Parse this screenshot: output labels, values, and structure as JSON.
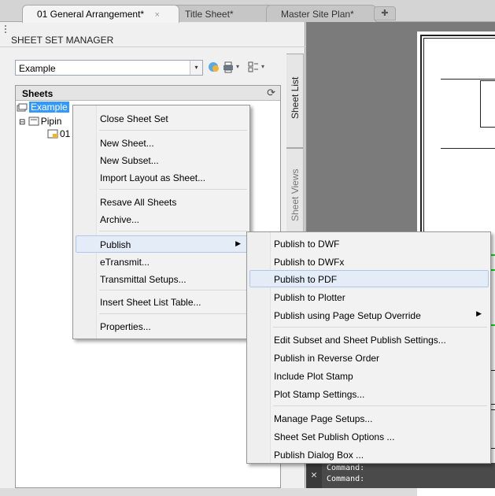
{
  "tabs": [
    {
      "label": "01 General Arrangement*",
      "close": "×",
      "active": true
    },
    {
      "label": "Title Sheet*",
      "active": false
    },
    {
      "label": "Master Site Plan*",
      "active": false
    }
  ],
  "palette": {
    "title": "SHEET SET MANAGER",
    "sheet_set_selector": {
      "value": "Example",
      "arrow": "▾"
    },
    "toolbar_icons": [
      "sheet-set-icon",
      "publish-icon",
      "view-options-icon"
    ],
    "sheets_header": "Sheets",
    "refresh_glyph": "⟳",
    "tree": [
      {
        "label": "Example",
        "selected": true
      },
      {
        "label": "Pipin"
      },
      {
        "label": "01"
      }
    ],
    "side_tabs": [
      "Sheet List",
      "Sheet Views"
    ]
  },
  "context_menu": {
    "items": [
      {
        "label": "Close Sheet Set"
      },
      {
        "label": "New Sheet..."
      },
      {
        "label": "New Subset..."
      },
      {
        "label": "Import Layout as Sheet..."
      },
      {
        "label": "Resave All Sheets"
      },
      {
        "label": "Archive..."
      },
      {
        "label": "Publish",
        "submenu": true
      },
      {
        "label": "eTransmit..."
      },
      {
        "label": "Transmittal Setups..."
      },
      {
        "label": "Insert Sheet List Table..."
      },
      {
        "label": "Properties..."
      }
    ],
    "submenu_arrow": "▶"
  },
  "publish_submenu": {
    "items": [
      {
        "label": "Publish to DWF"
      },
      {
        "label": "Publish to DWFx"
      },
      {
        "label": "Publish to PDF",
        "highlighted": true
      },
      {
        "label": "Publish to Plotter"
      },
      {
        "label": "Publish using Page Setup Override",
        "submenu": true
      },
      {
        "label": "Edit Subset and Sheet Publish Settings..."
      },
      {
        "label": "Publish in Reverse Order"
      },
      {
        "label": "Include Plot Stamp"
      },
      {
        "label": "Plot Stamp Settings..."
      },
      {
        "label": "Manage Page Setups..."
      },
      {
        "label": "Sheet Set Publish Options ..."
      },
      {
        "label": "Publish Dialog Box ..."
      }
    ]
  },
  "command_line": {
    "close_glyph": "✕",
    "lines": [
      "Command:",
      "Command:"
    ]
  },
  "colors": {
    "selection": "#3399ff",
    "menu_highlight": "#e4ecf7",
    "drawing_bg": "#7b7b7b",
    "green_lines": "#1bd61b"
  }
}
